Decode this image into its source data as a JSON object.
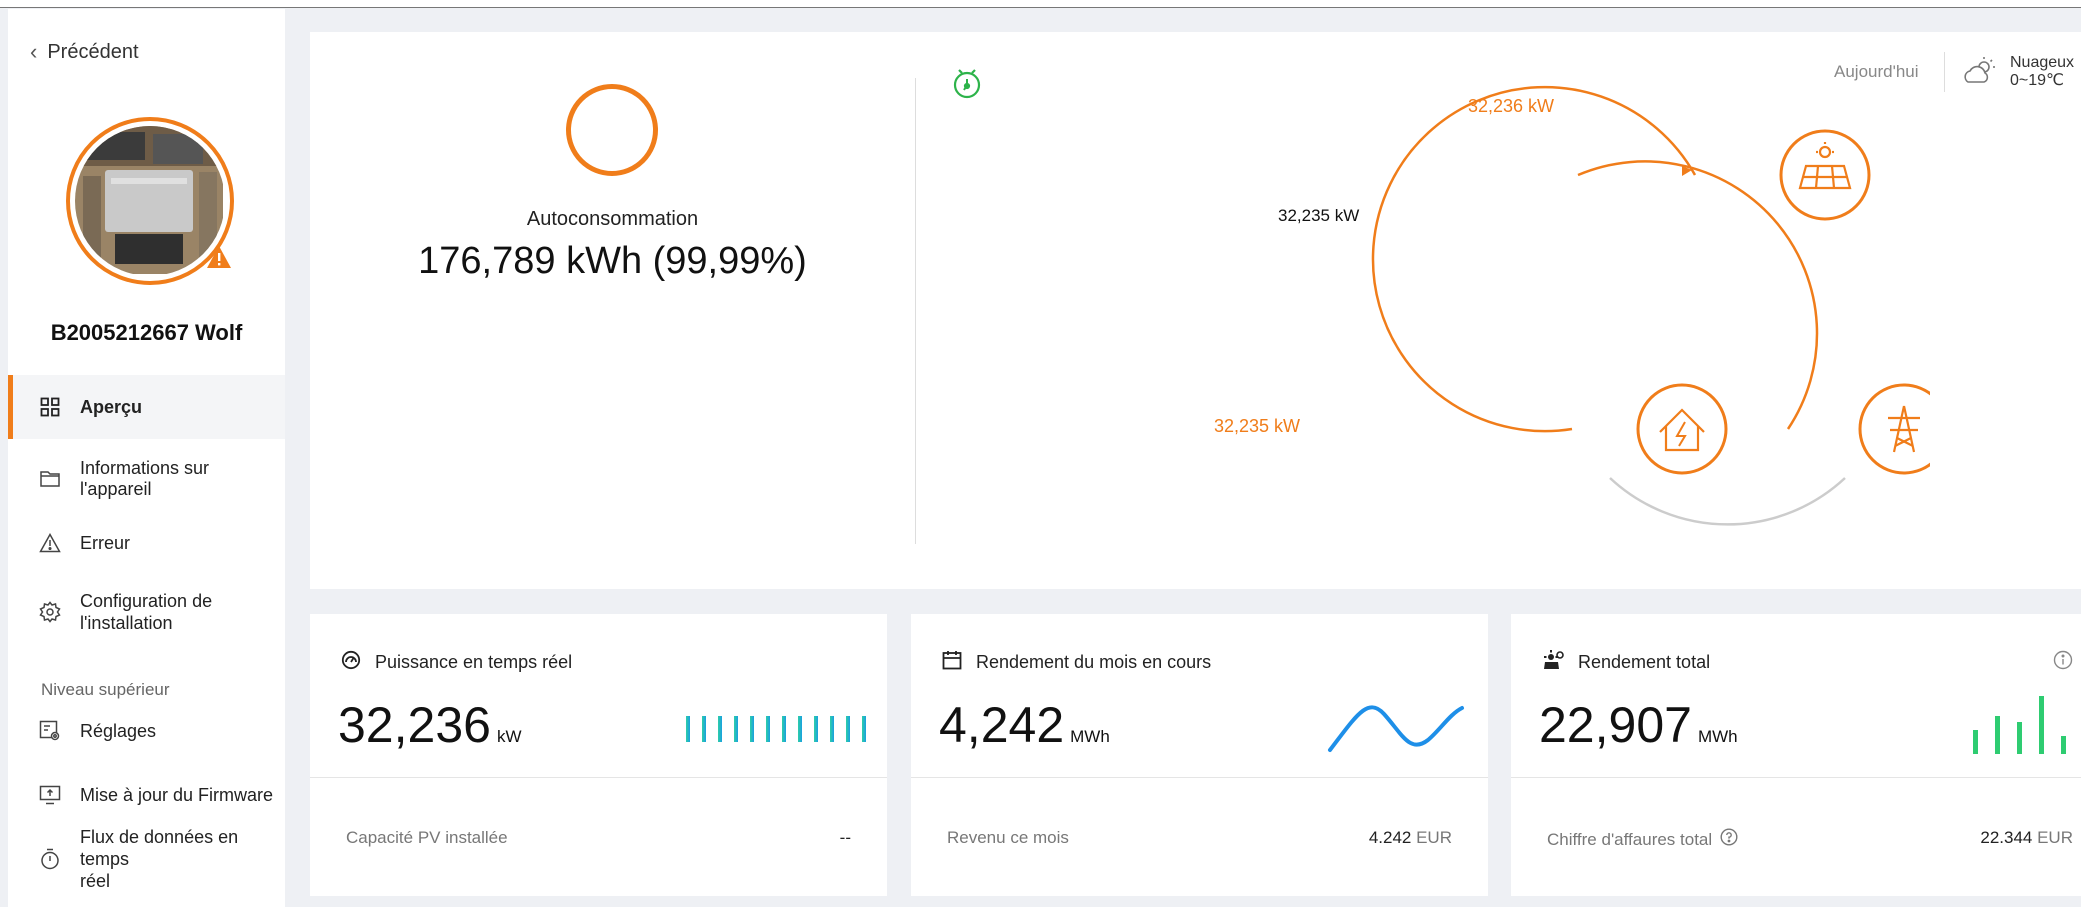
{
  "sidebar": {
    "back_label": "Précédent",
    "device_name": "B2005212667 Wolf",
    "items": [
      {
        "label": "Aperçu",
        "icon": "grid-icon",
        "active": true
      },
      {
        "label": "Informations sur l'appareil",
        "icon": "folder-icon"
      },
      {
        "label": "Erreur",
        "icon": "warning-icon"
      },
      {
        "label": "Configuration de l'installation",
        "line1": "Configuration de",
        "line2": "l'installation",
        "icon": "gear-icon"
      }
    ],
    "section_label": "Niveau supérieur",
    "section_items": [
      {
        "label": "Réglages",
        "icon": "settings-icon"
      },
      {
        "label": "Mise à jour du Firmware",
        "icon": "monitor-icon"
      },
      {
        "label": "Flux de données en temps réel",
        "line1": "Flux de données en temps",
        "line2": "réel",
        "icon": "stopwatch-icon"
      }
    ]
  },
  "overview": {
    "self_consumption_label": "Autoconsommation",
    "self_consumption_value": "176,789 kWh (99,99%)"
  },
  "flow": {
    "pv_power": "32,236 kW",
    "pv_to_home": "32,235 kW",
    "home_power": "32,235 kW"
  },
  "header": {
    "today_label": "Aujourd'hui",
    "weather_condition": "Nuageux",
    "weather_temp": "0~19℃"
  },
  "cards": [
    {
      "title": "Puissance en temps réel",
      "value": "32,236",
      "unit": "kW",
      "foot_label": "Capacité PV installée",
      "foot_value": "--",
      "foot_unit": ""
    },
    {
      "title": "Rendement du mois en cours",
      "value": "4,242",
      "unit": "MWh",
      "foot_label": "Revenu ce mois",
      "foot_value": "4.242",
      "foot_unit": "EUR"
    },
    {
      "title": "Rendement total",
      "value": "22,907",
      "unit": "MWh",
      "foot_label": "Chiffre d'affaures total",
      "foot_value": "22.344",
      "foot_unit": "EUR"
    }
  ],
  "colors": {
    "accent": "#f07d1a",
    "teal": "#2ec7b0",
    "blue": "#1e90e8",
    "green": "#2ecc71"
  }
}
